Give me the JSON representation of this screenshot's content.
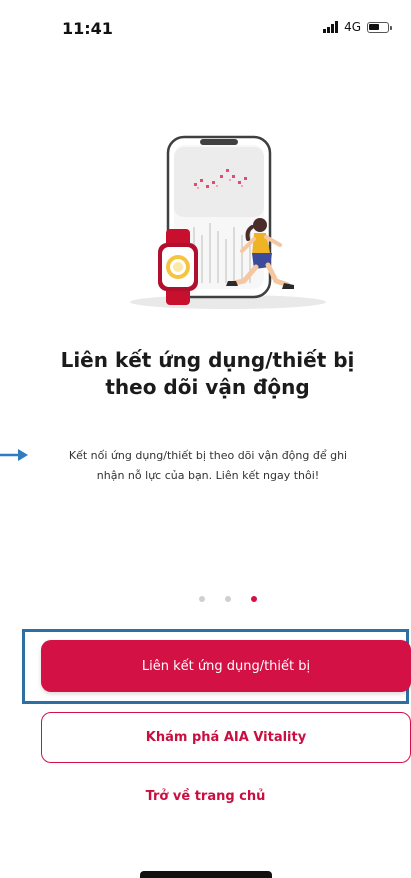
{
  "status_bar": {
    "time": "11:41",
    "network": "4G",
    "battery_level": 0.65
  },
  "onboarding": {
    "title": "Liên kết ứng dụng/thiết bị theo dõi vận động",
    "description": "Kết nối ứng dụng/thiết bị theo dõi vận động để ghi nhận nỗ lực của bạn. Liên kết ngay thôi!",
    "page_index": 3,
    "page_count": 3
  },
  "actions": {
    "primary_label": "Liên kết ứng dụng/thiết bị",
    "secondary_label": "Khám phá AIA Vitality",
    "home_link_label": "Trở về trang chủ"
  },
  "colors": {
    "brand": "#d31145",
    "highlight": "#2d6fa3",
    "arrow": "#2f7cc0"
  },
  "icons": {
    "illustration": "fitness-tracker-illustration",
    "annotation_arrow": "arrow-right-icon"
  }
}
